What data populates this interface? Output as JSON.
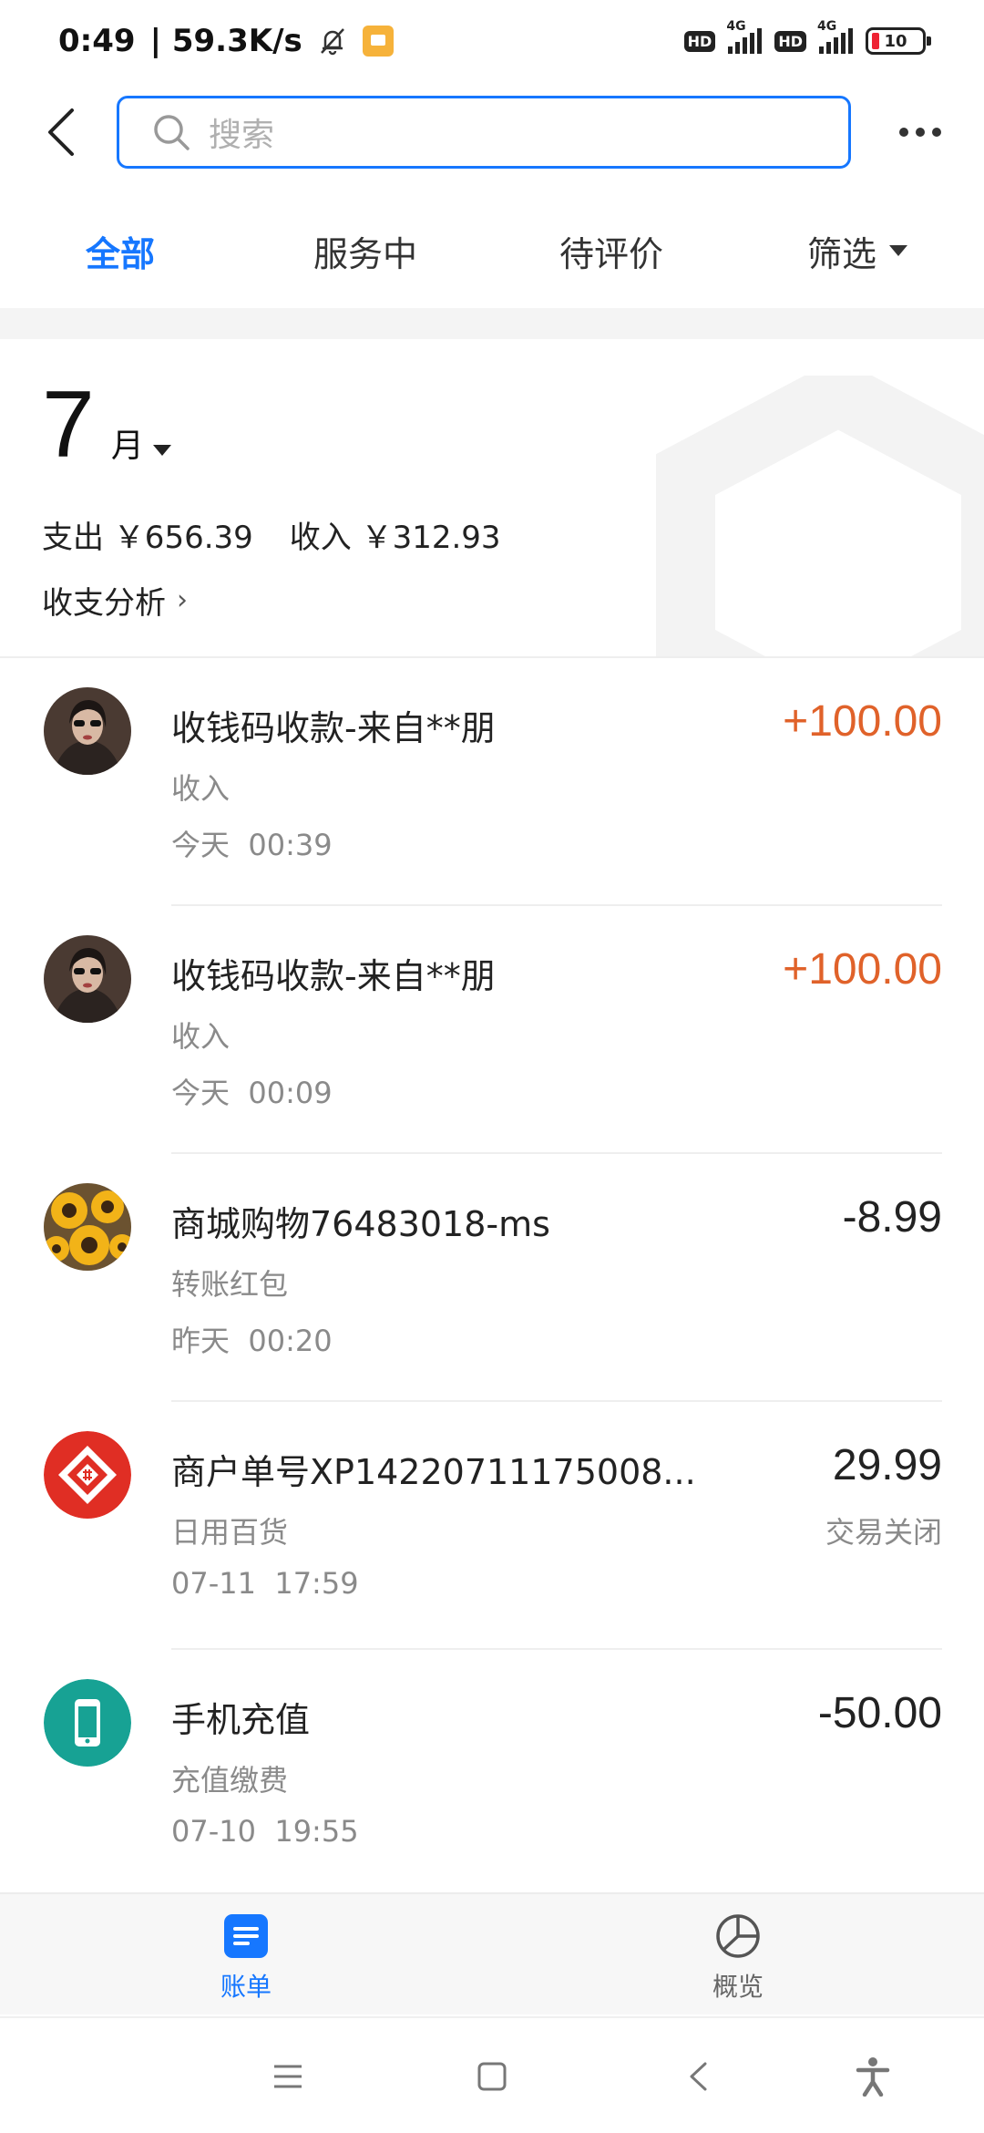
{
  "status_bar": {
    "time": "0:49",
    "speed": "| 59.3K/s",
    "network_tag_1": "4G",
    "network_tag_2": "4G",
    "hd_label": "HD",
    "battery": "10"
  },
  "header": {
    "search_placeholder": "搜索"
  },
  "tabs": [
    {
      "label": "全部",
      "active": true
    },
    {
      "label": "服务中",
      "active": false
    },
    {
      "label": "待评价",
      "active": false
    },
    {
      "label": "筛选",
      "active": false
    }
  ],
  "summary": {
    "month_number": "7",
    "month_unit": "月",
    "expense": "支出 ￥656.39",
    "income": "收入 ￥312.93",
    "analysis_link": "收支分析"
  },
  "transactions": [
    {
      "title": "收钱码收款-来自**朋",
      "category": "收入",
      "time": "今天  00:39",
      "amount": "+100.00",
      "type": "income",
      "icon": "person-avatar"
    },
    {
      "title": "收钱码收款-来自**朋",
      "category": "收入",
      "time": "今天  00:09",
      "amount": "+100.00",
      "type": "income",
      "icon": "person-avatar"
    },
    {
      "title": "商城购物76483018-ms",
      "category": "转账红包",
      "time": "昨天  00:20",
      "amount": "-8.99",
      "type": "expense",
      "icon": "sunflower-avatar"
    },
    {
      "title": "商户单号XP14220711175008...",
      "category": "日用百货",
      "time": "07-11  17:59",
      "amount": "29.99",
      "status": "交易关闭",
      "type": "closed",
      "icon": "pinduoduo-logo"
    },
    {
      "title": "手机充值",
      "category": "充值缴费",
      "time": "07-10  19:55",
      "amount": "-50.00",
      "type": "expense",
      "icon": "phone-recharge-icon"
    }
  ],
  "bottom_nav": [
    {
      "label": "账单",
      "active": true,
      "icon": "bill-icon"
    },
    {
      "label": "概览",
      "active": false,
      "icon": "pie-chart-icon"
    }
  ],
  "colors": {
    "accent": "#1677ff",
    "income": "#e0622a",
    "muted": "#8a8a8a"
  }
}
